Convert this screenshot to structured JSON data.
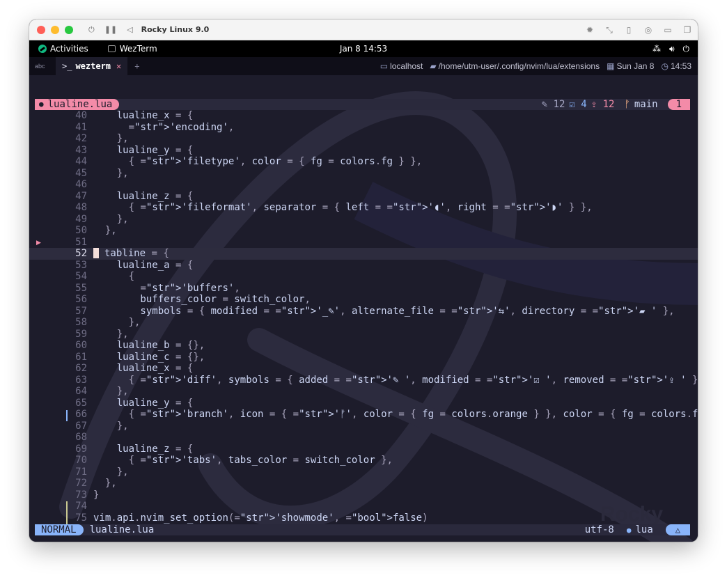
{
  "host": {
    "title": "Rocky Linux 9.0"
  },
  "gnome": {
    "activities": "Activities",
    "app": "WezTerm",
    "clock": "Jan 8  14:53"
  },
  "wezterm": {
    "abc_label": "abc",
    "tab_prompt": ">_",
    "tab_label": "wezterm",
    "tab_close": "✕",
    "tab_new": "+",
    "status": {
      "host": "localhost",
      "path": "/home/utm-user/.config/nvim/lua/extensions",
      "date": "Sun Jan 8",
      "time": "14:53"
    }
  },
  "tabline": {
    "filename": "lualine.lua",
    "added": "12",
    "modified": "4",
    "removed": "12",
    "branch_icon": "ᚠ",
    "branch": "main",
    "tab_number": "1"
  },
  "statusline": {
    "mode": "NORMAL",
    "filename": "lualine.lua",
    "encoding": "utf-8",
    "filetype": "lua"
  },
  "code": {
    "current_line": 52,
    "lines": [
      {
        "n": "40",
        "t": "    lualine_x = {"
      },
      {
        "n": "41",
        "t": "      'encoding',"
      },
      {
        "n": "42",
        "t": "    },"
      },
      {
        "n": "43",
        "t": "    lualine_y = {"
      },
      {
        "n": "44",
        "t": "      { 'filetype', color = { fg = colors.fg } },"
      },
      {
        "n": "45",
        "t": "    },"
      },
      {
        "n": "46",
        "t": ""
      },
      {
        "n": "47",
        "t": "    lualine_z = {"
      },
      {
        "n": "48",
        "t": "      { 'fileformat', separator = { left = '◖', right = '◗' } },"
      },
      {
        "n": "49",
        "t": "    },"
      },
      {
        "n": "50",
        "t": "  },"
      },
      {
        "n": "51",
        "t": ""
      },
      {
        "n": "52",
        "t": "tabline = {"
      },
      {
        "n": "53",
        "t": "    lualine_a = {"
      },
      {
        "n": "54",
        "t": "      {"
      },
      {
        "n": "55",
        "t": "        'buffers',"
      },
      {
        "n": "56",
        "t": "        buffers_color = switch_color,"
      },
      {
        "n": "57",
        "t": "        symbols = { modified = '_✎', alternate_file = '⇆', directory = '▰ ' },"
      },
      {
        "n": "58",
        "t": "      },"
      },
      {
        "n": "59",
        "t": "    },"
      },
      {
        "n": "60",
        "t": "    lualine_b = {},"
      },
      {
        "n": "61",
        "t": "    lualine_c = {},"
      },
      {
        "n": "62",
        "t": "    lualine_x = {"
      },
      {
        "n": "63",
        "t": "      { 'diff', symbols = { added = '✎ ', modified = '☑ ', removed = '⇪ ' } },"
      },
      {
        "n": "64",
        "t": "    },"
      },
      {
        "n": "65",
        "t": "    lualine_y = {"
      },
      {
        "n": "66",
        "t": "      { 'branch', icon = { 'ᚠ', color = { fg = colors.orange } }, color = { fg = colors.fg } },"
      },
      {
        "n": "67",
        "t": "    },"
      },
      {
        "n": "68",
        "t": ""
      },
      {
        "n": "69",
        "t": "    lualine_z = {"
      },
      {
        "n": "70",
        "t": "      { 'tabs', tabs_color = switch_color },"
      },
      {
        "n": "71",
        "t": "    },"
      },
      {
        "n": "72",
        "t": "  },"
      },
      {
        "n": "73",
        "t": "}"
      },
      {
        "n": "74",
        "t": ""
      },
      {
        "n": "75",
        "t": "vim.api.nvim_set_option('showmode', false)"
      }
    ]
  },
  "colors": {
    "background": "#1d1c2b",
    "accent_pink": "#f38ba8",
    "accent_blue": "#89b4fa",
    "string": "#dfc08a",
    "orange": "#fab387"
  }
}
